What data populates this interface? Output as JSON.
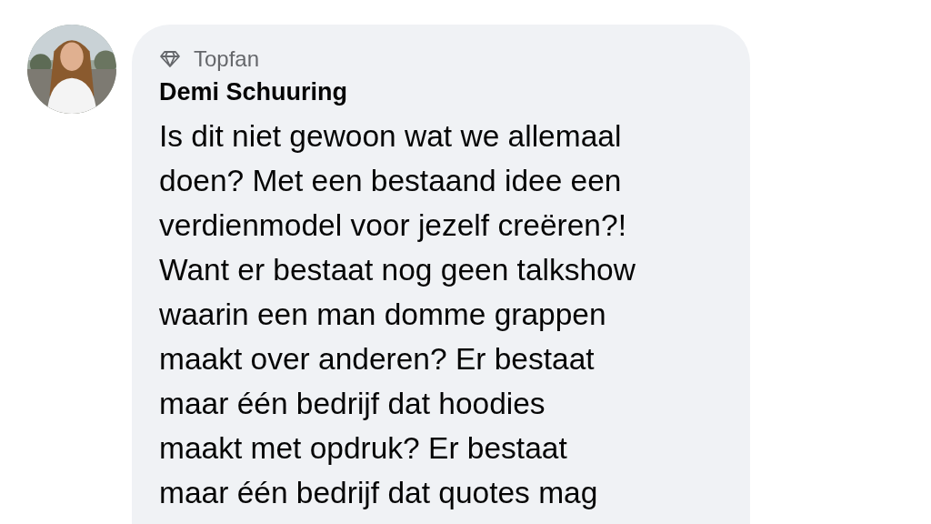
{
  "comment": {
    "badge": {
      "label": "Topfan"
    },
    "author": "Demi Schuuring",
    "body_lines": [
      "Is dit niet gewoon wat we allemaal",
      "doen? Met een bestaand idee een",
      "verdienmodel voor jezelf creëren?!",
      "Want er bestaat nog geen talkshow",
      "waarin een man domme grappen",
      "maakt over anderen? Er bestaat",
      "maar één bedrijf dat hoodies",
      "maakt met opdruk? Er bestaat",
      "maar één bedrijf dat quotes mag"
    ]
  }
}
